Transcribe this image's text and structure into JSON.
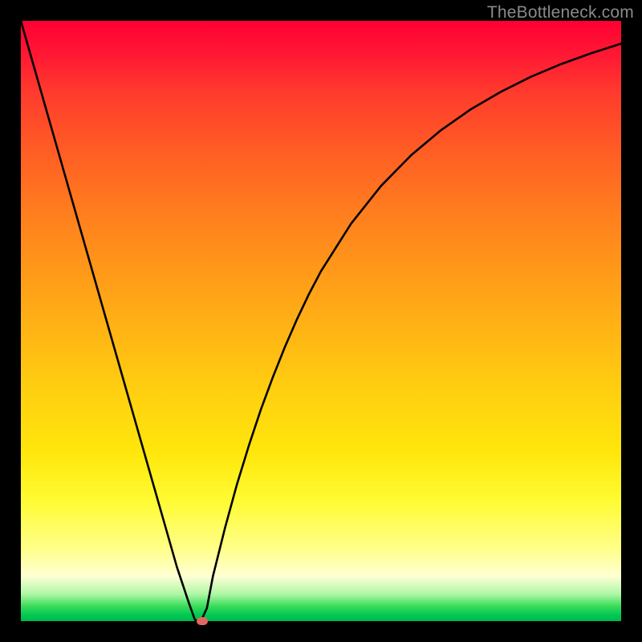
{
  "watermark": "TheBottleneck.com",
  "colors": {
    "frame": "#000000",
    "curve": "#000000",
    "marker": "#e06660",
    "gradient_top": "#ff0033",
    "gradient_bottom": "#00b84c"
  },
  "chart_data": {
    "type": "line",
    "title": "",
    "xlabel": "",
    "ylabel": "",
    "xlim": [
      0,
      100
    ],
    "ylim": [
      0,
      100
    ],
    "grid": false,
    "legend": false,
    "x": [
      0,
      2,
      4,
      6,
      8,
      10,
      12,
      14,
      16,
      18,
      20,
      22,
      24,
      26,
      28,
      29,
      30,
      31,
      32,
      34,
      36,
      38,
      40,
      42,
      44,
      46,
      48,
      50,
      55,
      60,
      65,
      70,
      75,
      80,
      85,
      90,
      95,
      100
    ],
    "values": [
      100,
      93,
      86,
      79,
      72,
      65,
      58,
      51,
      44,
      37,
      30,
      23,
      16,
      9,
      3,
      0.2,
      0,
      2.2,
      7.5,
      15.5,
      22.8,
      29.3,
      35.3,
      40.7,
      45.7,
      50.3,
      54.5,
      58.3,
      66.2,
      72.5,
      77.6,
      81.8,
      85.3,
      88.2,
      90.7,
      92.8,
      94.6,
      96.2
    ],
    "minimum": {
      "x": 30,
      "y": 0
    },
    "marker_at": {
      "x": 30.2,
      "y": 0
    }
  }
}
